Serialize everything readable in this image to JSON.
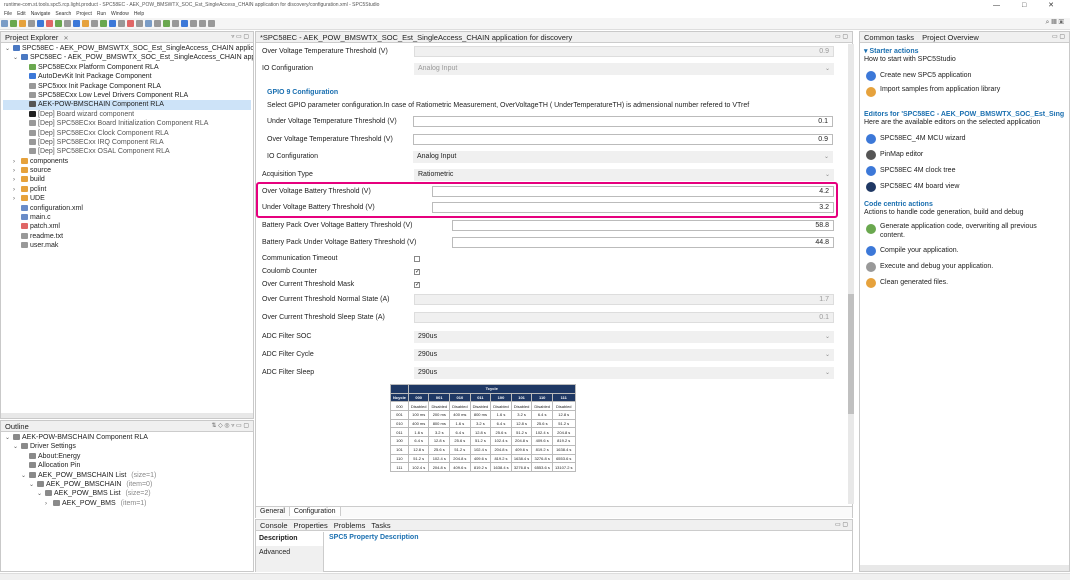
{
  "window": {
    "title": "runtime-com.st.tools.spc5.rcp.light.product - SPC58EC - AEK_POW_BMSWTX_SOC_Est_SingleAccess_CHAIN application for discovery/configuration.xml - SPC5Studio",
    "controls": "—   □   ✕"
  },
  "menu": [
    "File",
    "Edit",
    "Navigate",
    "Search",
    "Project",
    "Run",
    "Window",
    "Help"
  ],
  "project_explorer": {
    "tab_label": "Project Explorer",
    "tab_close": "✕",
    "items": [
      {
        "indent": 0,
        "arrow": "⌄",
        "label": "SPC58EC - AEK_POW_BMSWTX_SOC_Est_SingleAccess_CHAIN applic",
        "color": "#4a78c2"
      },
      {
        "indent": 1,
        "arrow": "⌄",
        "label": "SPC58EC - AEK_POW_BMSWTX_SOC_Est_SingleAccess_CHAIN app",
        "color": "#4a78c2"
      },
      {
        "indent": 2,
        "arrow": "",
        "label": "SPC58ECxx Platform Component RLA",
        "color": "#6aa84f"
      },
      {
        "indent": 2,
        "arrow": "",
        "label": "AutoDevKit Init Package Component",
        "color": "#3c78d8"
      },
      {
        "indent": 2,
        "arrow": "",
        "label": "SPC5xxx Init Package Component RLA",
        "color": "#999999"
      },
      {
        "indent": 2,
        "arrow": "",
        "label": "SPC58ECxx Low Level Drivers Component RLA",
        "color": "#999999"
      },
      {
        "indent": 2,
        "arrow": "",
        "label": "AEK-POW-BMSCHAIN Component RLA",
        "color": "#555555",
        "selected": true
      },
      {
        "indent": 2,
        "arrow": "",
        "label": "[Dep] Board wizard component",
        "color": "#222222",
        "dep": true
      },
      {
        "indent": 2,
        "arrow": "",
        "label": "[Dep] SPC58ECxx Board Initialization Component RLA",
        "color": "#999999",
        "dep": true
      },
      {
        "indent": 2,
        "arrow": "",
        "label": "[Dep] SPC58ECxx Clock Component RLA",
        "color": "#999999",
        "dep": true
      },
      {
        "indent": 2,
        "arrow": "",
        "label": "[Dep] SPC58ECxx IRQ Component RLA",
        "color": "#999999",
        "dep": true
      },
      {
        "indent": 2,
        "arrow": "",
        "label": "[Dep] SPC58ECxx OSAL Component RLA",
        "color": "#999999",
        "dep": true
      },
      {
        "indent": 1,
        "arrow": "›",
        "label": "components",
        "color": "#e6a23c"
      },
      {
        "indent": 1,
        "arrow": "›",
        "label": "source",
        "color": "#e6a23c"
      },
      {
        "indent": 1,
        "arrow": "›",
        "label": "build",
        "color": "#e6a23c"
      },
      {
        "indent": 1,
        "arrow": "›",
        "label": "pclint",
        "color": "#e6a23c"
      },
      {
        "indent": 1,
        "arrow": "›",
        "label": "UDE",
        "color": "#e6a23c"
      },
      {
        "indent": 1,
        "arrow": "",
        "label": "configuration.xml",
        "color": "#6a8cc8"
      },
      {
        "indent": 1,
        "arrow": "",
        "label": "main.c",
        "color": "#6a8cc8"
      },
      {
        "indent": 1,
        "arrow": "",
        "label": "patch.xml",
        "color": "#e06666"
      },
      {
        "indent": 1,
        "arrow": "",
        "label": "readme.txt",
        "color": "#999999"
      },
      {
        "indent": 1,
        "arrow": "",
        "label": "user.mak",
        "color": "#999999"
      }
    ]
  },
  "outline": {
    "tab_label": "Outline",
    "items": [
      {
        "indent": 0,
        "arrow": "⌄",
        "label": "AEK-POW-BMSCHAIN Component RLA",
        "suffix": ""
      },
      {
        "indent": 1,
        "arrow": "⌄",
        "label": "Driver Settings",
        "suffix": ""
      },
      {
        "indent": 2,
        "arrow": "",
        "label": "About:Energy",
        "suffix": ""
      },
      {
        "indent": 2,
        "arrow": "",
        "label": "Allocation Pin",
        "suffix": ""
      },
      {
        "indent": 2,
        "arrow": "⌄",
        "label": "AEK_POW_BMSCHAIN List",
        "suffix": "(size=1)"
      },
      {
        "indent": 3,
        "arrow": "⌄",
        "label": "AEK_POW_BMSCHAIN",
        "suffix": "(item=0)"
      },
      {
        "indent": 4,
        "arrow": "⌄",
        "label": "AEK_POW_BMS List",
        "suffix": "(size=2)"
      },
      {
        "indent": 5,
        "arrow": "›",
        "label": "AEK_POW_BMS",
        "suffix": "(item=1)"
      }
    ]
  },
  "editor": {
    "tab_label": "*SPC58EC - AEK_POW_BMSWTX_SOC_Est_SingleAccess_CHAIN application for discovery",
    "top_rows": {
      "ovt_label": "Over Voltage Temperature Threshold (V)",
      "ovt_value": "0.9",
      "io1_label": "IO Configuration",
      "io1_value": "Analog Input"
    },
    "gpio9": {
      "title": "GPIO 9 Configuration",
      "desc": "Select GPIO parameter configuration.In case of Ratiometric Measurement, OverVoltageTH ( UnderTemperatureTH) is admensional number refered to VTref",
      "uvt_label": "Under Voltage Temperature Threshold (V)",
      "uvt_value": "0.1",
      "ovt_label": "Over Voltage Temperature Threshold (V)",
      "ovt_value": "0.9",
      "io_label": "IO Configuration",
      "io_value": "Analog Input"
    },
    "acq_label": "Acquisition Type",
    "acq_value": "Ratiometric",
    "ovb_label": "Over Voltage Battery Threshold (V)",
    "ovb_value": "4.2",
    "uvb_label": "Under Voltage Battery Threshold (V)",
    "uvb_value": "3.2",
    "bpov_label": "Battery Pack Over Voltage Battery Threshold (V)",
    "bpov_value": "58.8",
    "bpuv_label": "Battery Pack Under Voltage Battery Threshold (V)",
    "bpuv_value": "44.8",
    "comm_label": "Communication Timeout",
    "comm_checked": false,
    "coulomb_label": "Coulomb Counter",
    "coulomb_checked": true,
    "ocm_label": "Over Current Threshold Mask",
    "ocm_checked": true,
    "ocn_label": "Over Current Threshold Normal State (A)",
    "ocn_value": "1.7",
    "ocs_label": "Over Current Threshold Sleep State (A)",
    "ocs_value": "0.1",
    "adc_soc_label": "ADC Filter SOC",
    "adc_soc_value": "290us",
    "adc_cycle_label": "ADC Filter Cycle",
    "adc_cycle_value": "290us",
    "adc_sleep_label": "ADC Filter Sleep",
    "adc_sleep_value": "290us",
    "bottom_tabs": [
      "General",
      "Configuration"
    ]
  },
  "tcycle_table": {
    "top_header": "Tcycle",
    "row_header": "Ncycle",
    "columns": [
      "000",
      "001",
      "010",
      "011",
      "100",
      "101",
      "110",
      "111"
    ],
    "rows": [
      [
        "000",
        "Disabled",
        "Disabled",
        "Disabled",
        "Disabled",
        "Disabled",
        "Disabled",
        "Disabled",
        "Disabled"
      ],
      [
        "001",
        "100 ms",
        "200 ms",
        "400 ms",
        "800 ms",
        "1.6 s",
        "3.2 s",
        "6.4 s",
        "12.8 s"
      ],
      [
        "010",
        "400 ms",
        "800 ms",
        "1.6 s",
        "3.2 s",
        "6.4 s",
        "12.8 s",
        "25.6 s",
        "51.2 s"
      ],
      [
        "011",
        "1.6 s",
        "3.2 s",
        "6.4 s",
        "12.8 s",
        "25.6 s",
        "51.2 s",
        "102.4 s",
        "204.8 s"
      ],
      [
        "100",
        "6.4 s",
        "12.8 s",
        "25.6 s",
        "51.2 s",
        "102.4 s",
        "204.8 s",
        "409.6 s",
        "819.2 s"
      ],
      [
        "101",
        "12.8 s",
        "25.6 s",
        "51.2 s",
        "102.4 s",
        "204.8 s",
        "409.6 s",
        "819.2 s",
        "1638.4 s"
      ],
      [
        "110",
        "51.2 s",
        "102.4 s",
        "204.8 s",
        "409.6 s",
        "819.2 s",
        "1638.4 s",
        "3276.8 s",
        "6553.6 s"
      ],
      [
        "111",
        "102.4 s",
        "204.8 s",
        "409.6 s",
        "819.2 s",
        "1638.4 s",
        "3276.8 s",
        "6553.6 s",
        "13107.2 s"
      ]
    ]
  },
  "bottom_panel": {
    "tabs": [
      "Console",
      "Properties",
      "Problems",
      "Tasks"
    ],
    "side_tabs": [
      "Description",
      "Advanced"
    ],
    "title": "SPC5 Property Description"
  },
  "right_panel": {
    "tab1": "Common tasks",
    "tab2": "Project Overview",
    "starter_title": "Starter actions",
    "starter_desc": "How to start with SPC5Studio",
    "starter_links": [
      {
        "label": "Create new SPC5 application",
        "icon": "create-app-icon",
        "color": "#3c78d8"
      },
      {
        "label": "Import samples from application library",
        "icon": "import-icon",
        "color": "#e6a23c"
      }
    ],
    "editors_title": "Editors for 'SPC58EC - AEK_POW_BMSWTX_SOC_Est_Sing",
    "editors_desc": "Here are the available editors on the selected application",
    "editor_links": [
      {
        "label": "SPC58EC_4M MCU wizard",
        "icon": "mcu-wizard-icon",
        "color": "#3c78d8"
      },
      {
        "label": "PinMap editor",
        "icon": "pinmap-icon",
        "color": "#555555"
      },
      {
        "label": "SPC58EC 4M clock tree",
        "icon": "clock-tree-icon",
        "color": "#3c78d8"
      },
      {
        "label": "SPC58EC 4M board view",
        "icon": "board-view-icon",
        "color": "#1f3864"
      }
    ],
    "code_title": "Code centric actions",
    "code_desc": "Actions to handle code generation, build and debug",
    "code_links": [
      {
        "label": "Generate application code, overwriting all previous content.",
        "icon": "generate-code-icon",
        "color": "#6aa84f"
      },
      {
        "label": "Compile your application.",
        "icon": "compile-icon",
        "color": "#3c78d8"
      },
      {
        "label": "Execute and debug your application.",
        "icon": "debug-icon",
        "color": "#999999"
      },
      {
        "label": "Clean generated files.",
        "icon": "clean-icon",
        "color": "#e6a23c"
      }
    ]
  },
  "colors": {
    "accent": "#1a6fb0",
    "highlight_border": "#e6007e",
    "table_header": "#1f3864",
    "selection": "#cde3f8"
  }
}
